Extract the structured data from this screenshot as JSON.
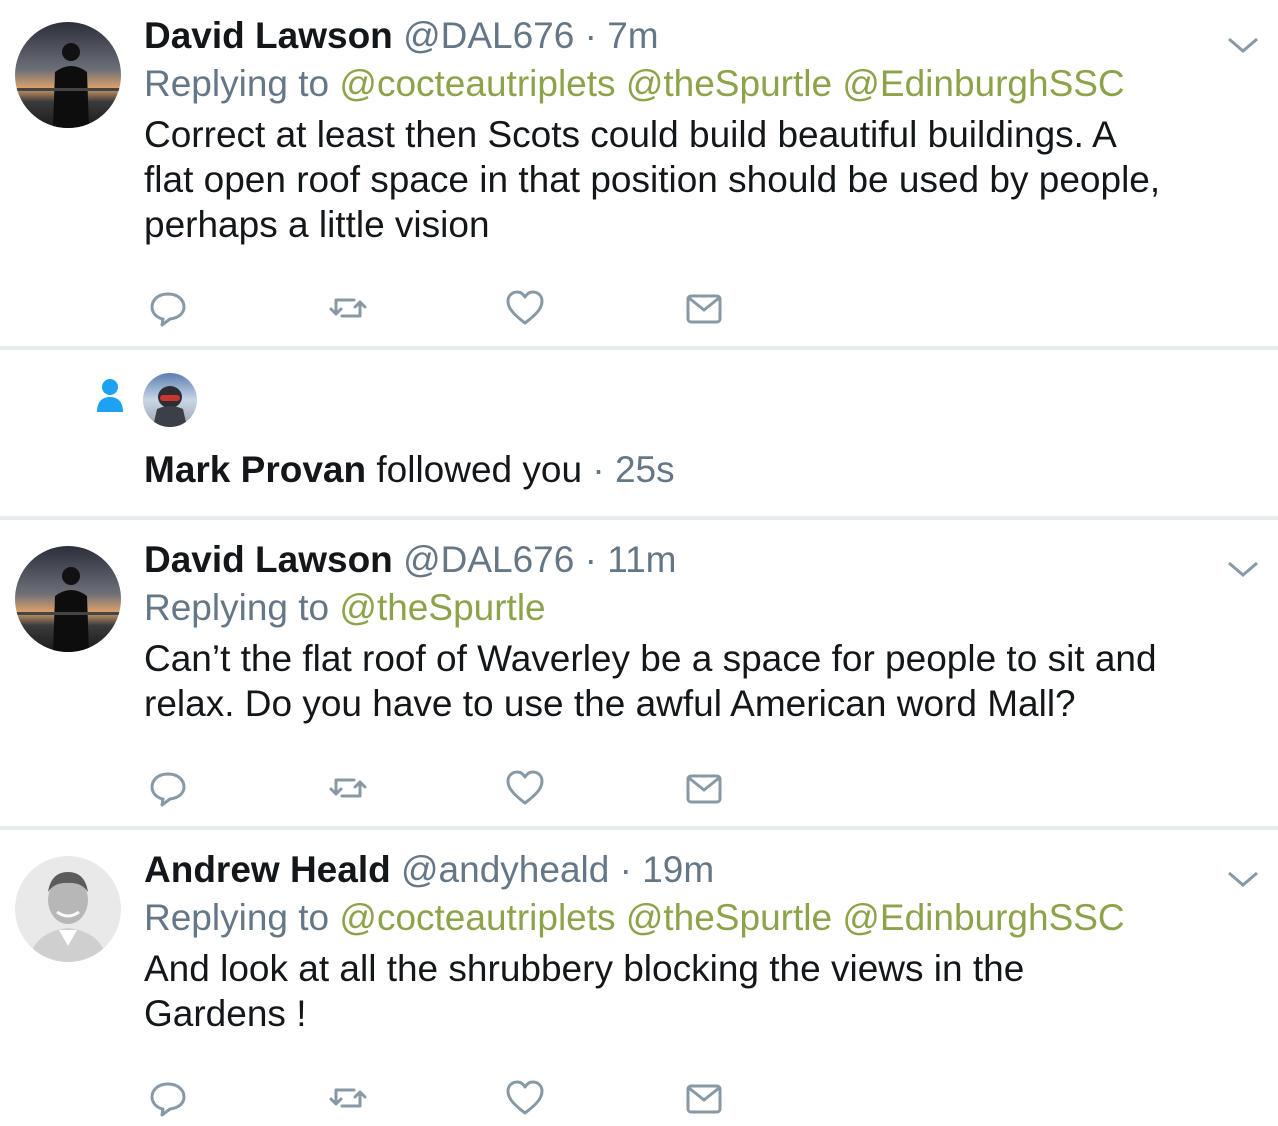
{
  "colors": {
    "mention": "#8da34a",
    "secondary_text": "#657786",
    "divider": "#e6ecf0",
    "follow_icon": "#1da1f2"
  },
  "tweets": [
    {
      "name": "David Lawson",
      "handle": "@DAL676",
      "dot": "·",
      "time": "7m",
      "replying_label": "Replying to",
      "mentions": [
        "@cocteautriplets",
        "@theSpurtle",
        "@EdinburghSSC"
      ],
      "text_lines": [
        "Correct at least then Scots could build beautiful buildings. A",
        "flat open roof space in that position should be used by people,",
        "perhaps a little vision"
      ],
      "avatar_icon": "profile-photo-sunset"
    },
    {
      "name": "David Lawson",
      "handle": "@DAL676",
      "dot": "·",
      "time": "11m",
      "replying_label": "Replying to",
      "mentions": [
        "@theSpurtle"
      ],
      "text_lines": [
        "Can’t the flat roof of Waverley be a space for people to sit and",
        "relax. Do you have to use the awful American word Mall?"
      ],
      "avatar_icon": "profile-photo-sunset"
    },
    {
      "name": "Andrew Heald",
      "handle": "@andyheald",
      "dot": "·",
      "time": "19m",
      "replying_label": "Replying to",
      "mentions": [
        "@cocteautriplets",
        "@theSpurtle",
        "@EdinburghSSC"
      ],
      "text_lines": [
        "And look at all the shrubbery blocking the views in the",
        "Gardens !"
      ],
      "avatar_icon": "profile-photo-portrait"
    }
  ],
  "follow_notification": {
    "name": "Mark Provan",
    "action": "followed you",
    "dot": "·",
    "time": "25s",
    "icon": "person-icon",
    "avatar_icon": "profile-photo-helmet"
  },
  "action_icons": [
    "reply-icon",
    "retweet-icon",
    "like-icon",
    "direct-message-icon"
  ]
}
